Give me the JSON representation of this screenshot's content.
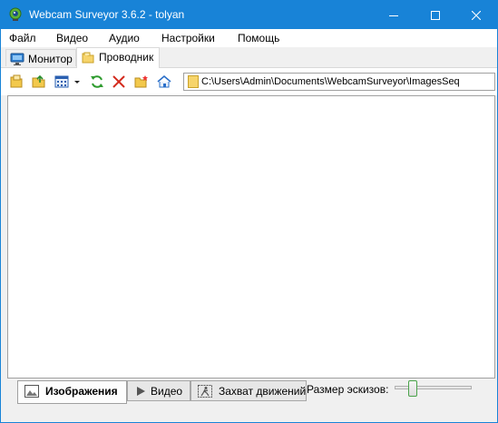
{
  "window": {
    "title": "Webcam Surveyor 3.6.2 - tolyan",
    "accent_color": "#1883d7",
    "icon": "webcam-icon"
  },
  "menu": {
    "items": [
      "Файл",
      "Видео",
      "Аудио",
      "Настройки",
      "Помощь"
    ]
  },
  "tabs": [
    {
      "label": "Монитор",
      "icon": "monitor-icon",
      "active": false
    },
    {
      "label": "Проводник",
      "icon": "folder-icon",
      "active": true
    }
  ],
  "toolbar": {
    "buttons": [
      "folders-icon",
      "folder-up-icon",
      "view-mode-icon",
      "dropdown-arrow-icon",
      "refresh-icon",
      "delete-icon",
      "new-folder-icon",
      "home-icon"
    ],
    "path": "C:\\Users\\Admin\\Documents\\WebcamSurveyor\\ImagesSeq"
  },
  "bottom": {
    "tabs": [
      {
        "label": "Изображения",
        "icon": "image-icon",
        "active": true
      },
      {
        "label": "Видео",
        "icon": "play-icon",
        "active": false
      },
      {
        "label": "Захват движений",
        "icon": "motion-icon",
        "active": false
      }
    ],
    "thumbnail_size_label": "Размер эскизов:",
    "thumbnail_size_value": 0.2
  }
}
